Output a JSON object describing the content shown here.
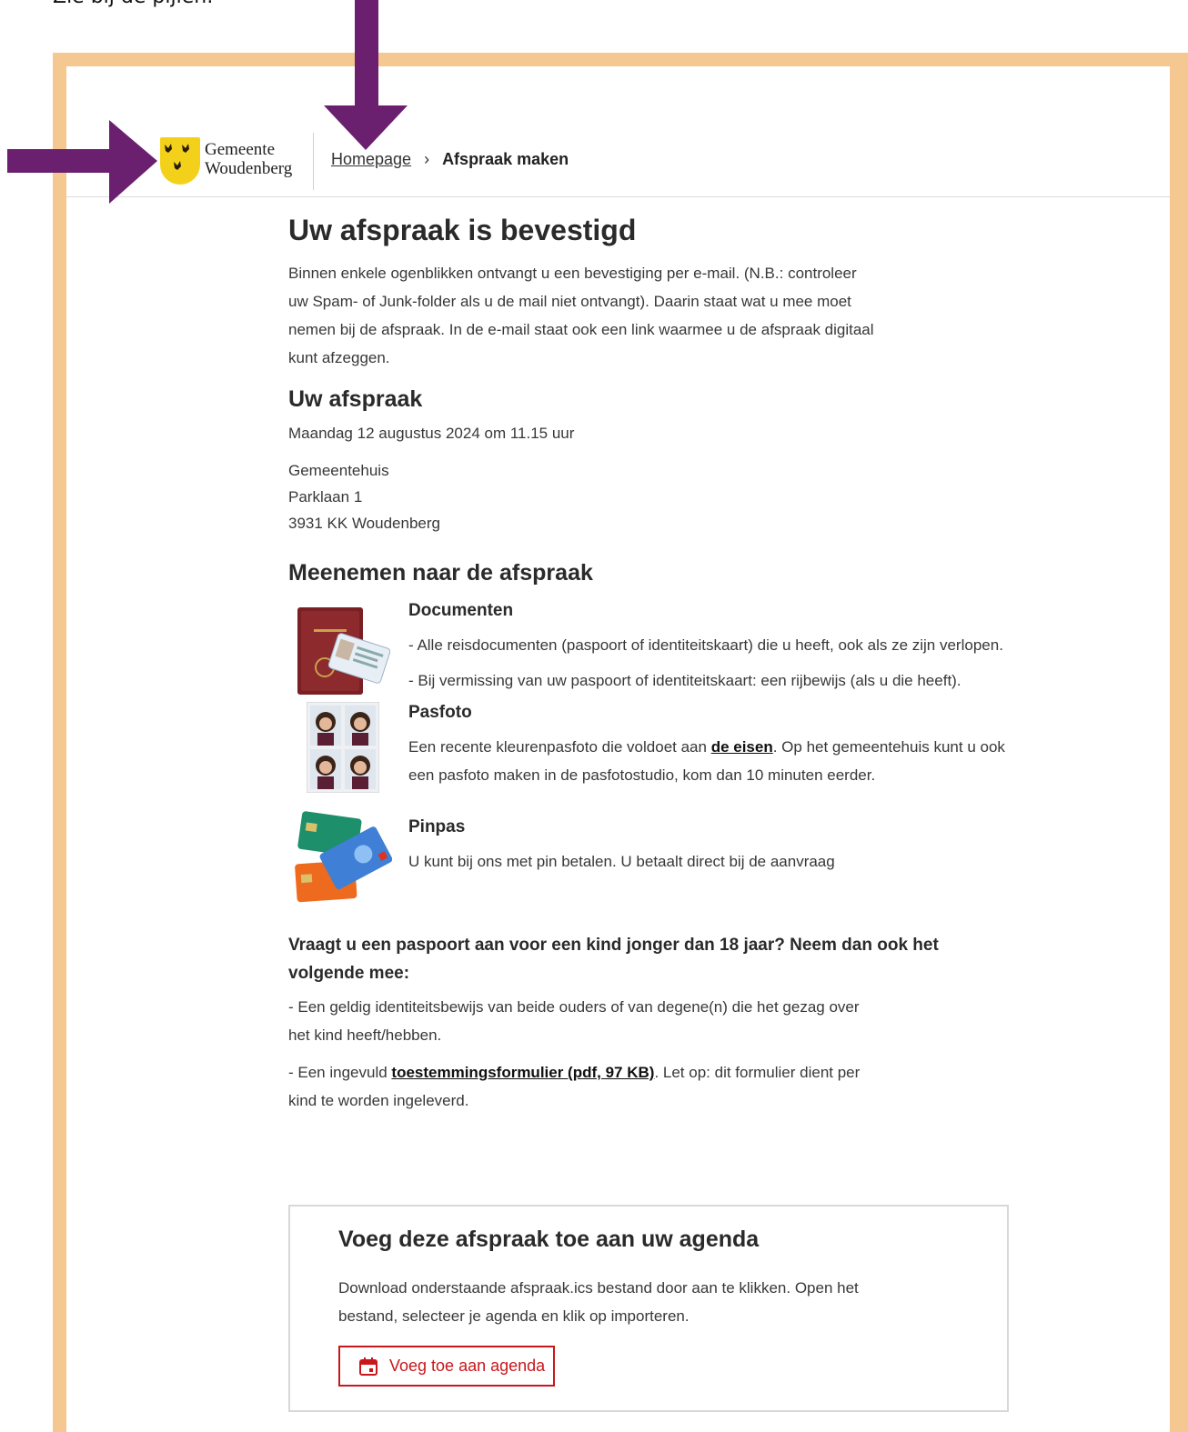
{
  "caption": "Zie bij de pijlen:",
  "header": {
    "logo_line1": "Gemeente",
    "logo_line2": "Woudenberg",
    "breadcrumb_home": "Homepage",
    "breadcrumb_separator": "›",
    "breadcrumb_current": "Afspraak maken"
  },
  "main": {
    "title": "Uw afspraak is bevestigd",
    "intro": "Binnen enkele ogenblikken ontvangt u een bevestiging per e-mail. (N.B.: controleer uw Spam- of Junk-folder als u de mail niet ontvangt). Daarin staat wat u mee moet nemen bij de afspraak. In de e-mail staat ook een link waarmee u de afspraak digitaal kunt afzeggen.",
    "appointment_heading": "Uw afspraak",
    "appointment_date": "Maandag 12 augustus 2024 om 11.15 uur",
    "location_name": "Gemeentehuis",
    "location_street": "Parklaan 1",
    "location_city": "3931 KK Woudenberg",
    "bring_heading": "Meenemen naar de afspraak",
    "documents": {
      "heading": "Documenten",
      "line1": "- Alle reisdocumenten (paspoort of identiteitskaart) die u heeft, ook als ze zijn verlopen.",
      "line2": "- Bij vermissing van uw paspoort of identiteitskaart: een rijbewijs (als u die heeft)."
    },
    "pasfoto": {
      "heading": "Pasfoto",
      "text_before": "Een recente kleurenpasfoto die voldoet aan ",
      "link": "de eisen",
      "text_after": ". Op het gemeentehuis kunt u ook een pasfoto maken in de pasfotostudio, kom dan 10 minuten eerder."
    },
    "pinpas": {
      "heading": "Pinpas",
      "text": "U kunt bij ons met pin betalen. U betaalt direct bij de aanvraag"
    },
    "child": {
      "heading": "Vraagt u een paspoort aan voor een kind jonger dan 18 jaar? Neem dan ook het volgende mee:",
      "line1": "- Een geldig identiteitsbewijs van beide ouders of van degene(n) die het gezag over het kind heeft/hebben.",
      "line2_before": "- Een ingevuld ",
      "line2_link": "toestemmingsformulier (pdf, 97 KB)",
      "line2_after": ". Let op: dit formulier dient per kind te worden ingeleverd."
    }
  },
  "agenda": {
    "heading": "Voeg deze afspraak toe aan uw agenda",
    "text": "Download onderstaande afspraak.ics bestand door aan te klikken. Open het bestand, selecteer je agenda en klik op importeren.",
    "button_label": "Voeg toe aan agenda"
  },
  "colors": {
    "frame": "#f5c791",
    "arrow": "#6b1f6f",
    "button_red": "#c9171c",
    "logo_yellow": "#f3d11b"
  },
  "icons": [
    "arrow-right-icon",
    "arrow-down-icon",
    "calendar-icon",
    "woudenberg-shield-logo"
  ]
}
